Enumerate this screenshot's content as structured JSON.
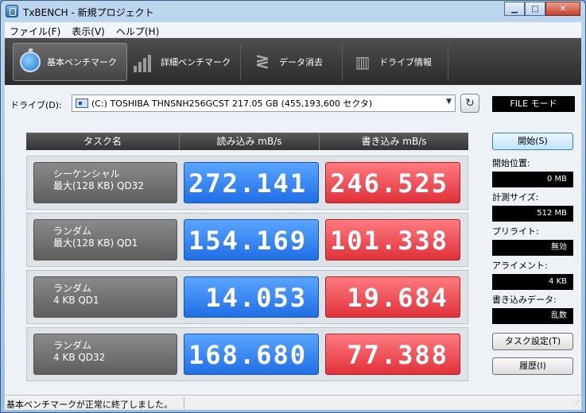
{
  "window": {
    "title": "TxBENCH - 新規プロジェクト"
  },
  "menu": [
    {
      "label": "ファイル(F)"
    },
    {
      "label": "表示(V)"
    },
    {
      "label": "ヘルプ(H)"
    }
  ],
  "toolbar": [
    {
      "label": "基本ベンチマーク",
      "icon": "stopwatch-icon"
    },
    {
      "label": "詳細ベンチマーク",
      "icon": "bar-chart-icon"
    },
    {
      "label": "データ消去",
      "icon": "eraser-icon"
    },
    {
      "label": "ドライブ情報",
      "icon": "drive-info-icon"
    }
  ],
  "drive": {
    "label": "ドライブ(D):",
    "selected": "(C:) TOSHIBA THNSNH256GCST  217.05 GB (455,193,600 セクタ)",
    "mode": "FILE モード"
  },
  "table": {
    "headers": {
      "task": "タスク名",
      "read": "読み込み mB/s",
      "write": "書き込み mB/s"
    },
    "rows": [
      {
        "name1": "シーケンシャル",
        "name2": "最大(128 KB) QD32",
        "read": "272.141",
        "write": "246.525"
      },
      {
        "name1": "ランダム",
        "name2": "最大(128 KB) QD1",
        "read": "154.169",
        "write": "101.338"
      },
      {
        "name1": "ランダム",
        "name2": "4 KB QD1",
        "read": "14.053",
        "write": "19.684"
      },
      {
        "name1": "ランダム",
        "name2": "4 KB QD32",
        "read": "168.680",
        "write": "77.388"
      }
    ]
  },
  "side": {
    "start_button": "開始(S)",
    "start_pos_label": "開始位置:",
    "start_pos_value": "0 MB",
    "size_label": "計測サイズ:",
    "size_value": "512 MB",
    "prewrite_label": "プリライト:",
    "prewrite_value": "無効",
    "align_label": "アライメント:",
    "align_value": "4 KB",
    "writedata_label": "書き込みデータ:",
    "writedata_value": "乱数",
    "task_settings_button": "タスク設定(T)",
    "history_button": "履歴(I)"
  },
  "status": {
    "text": "基本ベンチマークが正常に終了しました。"
  },
  "colors": {
    "read": "#2f7bef",
    "write": "#ea4750",
    "toolbar": "#3a3a3a"
  }
}
